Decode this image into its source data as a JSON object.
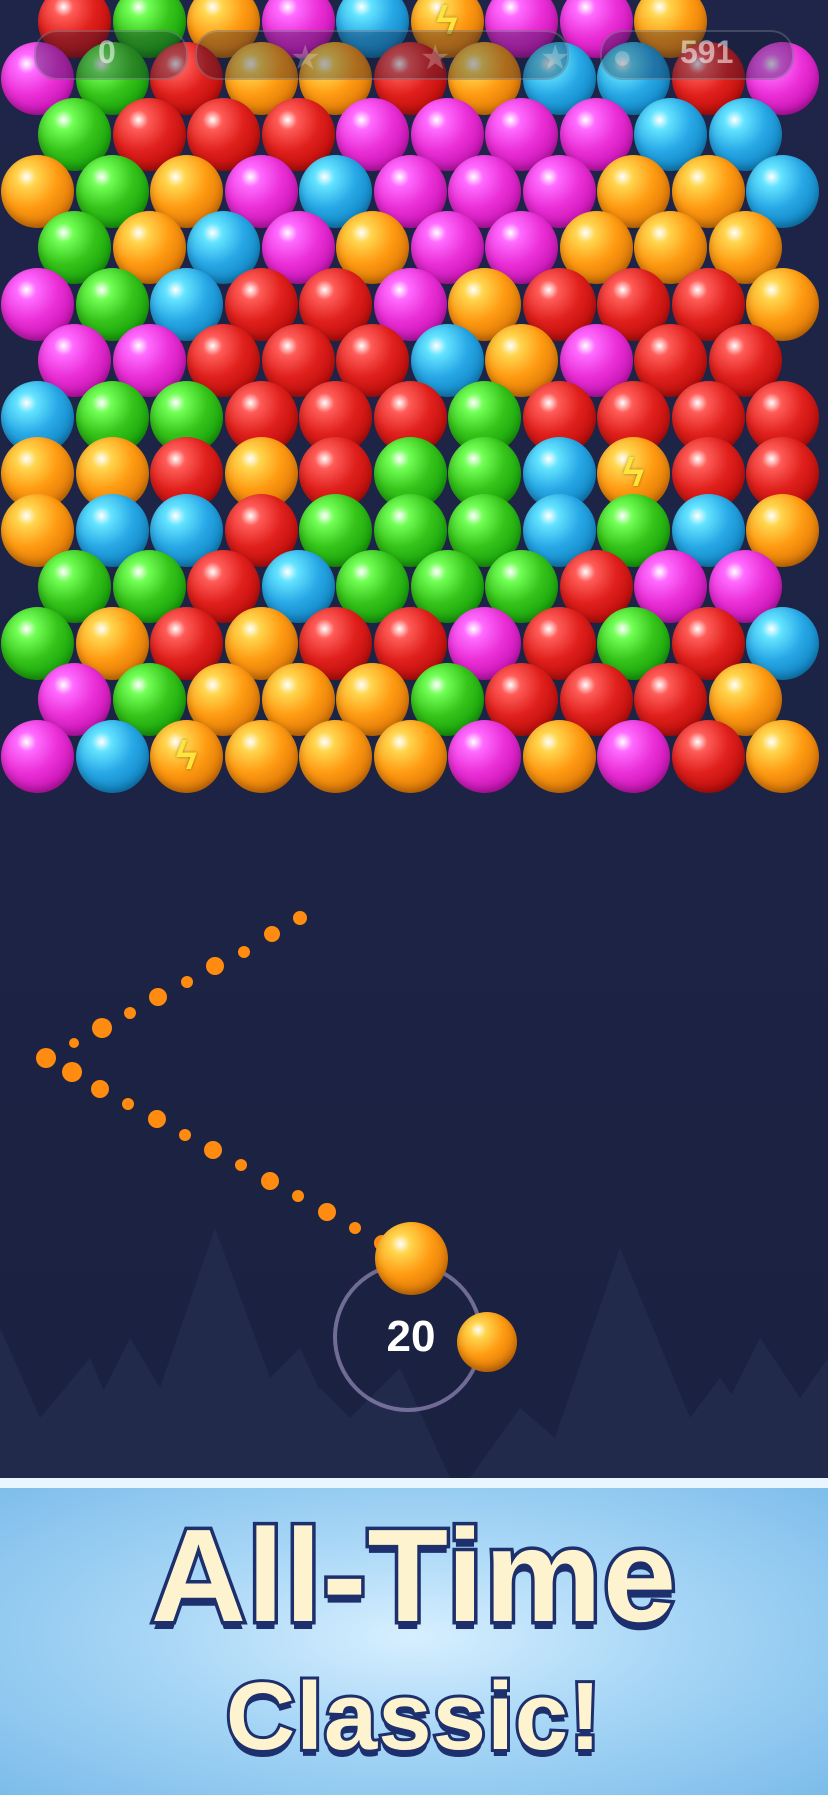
{
  "hud": {
    "score": "0",
    "coins": "591",
    "stars": [
      "star",
      "star",
      "star"
    ]
  },
  "grid": {
    "palette": {
      "R": "#e0201c",
      "G": "#36c41a",
      "O": "#ff9a12",
      "M": "#ea2fd6",
      "B": "#28a8e6",
      "L": "#ff9a12"
    },
    "rows": [
      "RGOMBLMMO",
      "MGROOROBBRM",
      "GRRRMMMMBB",
      "OGOMBMMMOOB",
      "GOBMOMMOOO",
      "MGBRRMORRRO",
      "MMRRRBOMRR",
      "BGGRRRGRRRR",
      "OORORGGBLRR",
      "OBBRGGGBGBO",
      "GGRBGGGRMM",
      "GORORRMRGRB",
      "MGOOOGRRRO",
      "MBLOOOMOMRO"
    ],
    "bolt_icon": "lightning-bolt-icon"
  },
  "shooter": {
    "moves_left": "20",
    "current_bubble_color": "#ff9a12",
    "next_bubble_color": "#ff9a12"
  },
  "banner": {
    "line1": "All-Time",
    "line2": "Classic!"
  }
}
